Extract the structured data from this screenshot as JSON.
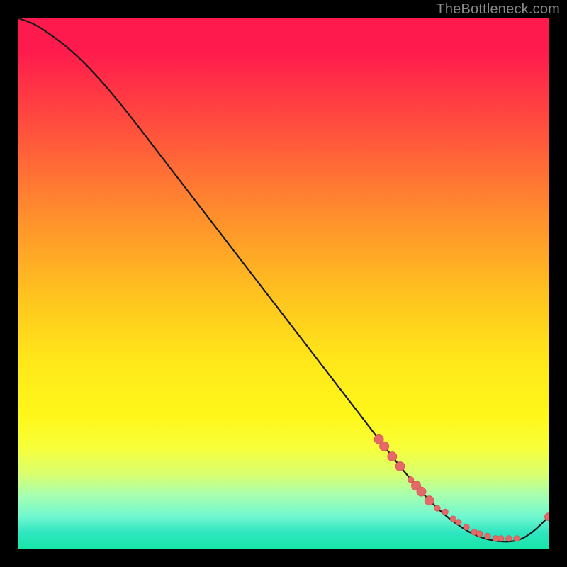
{
  "watermark": "TheBottleneck.com",
  "colors": {
    "background": "#000000",
    "curve": "#1a1a1a",
    "marker_fill": "#e46a6a",
    "marker_stroke": "#d94f4f",
    "gradient_top": "#ff1a4d",
    "gradient_bottom": "#18e6a8"
  },
  "chart_data": {
    "type": "line",
    "title": "",
    "xlabel": "",
    "ylabel": "",
    "xlim": [
      0,
      100
    ],
    "ylim": [
      0,
      100
    ],
    "grid": false,
    "legend": false,
    "series": [
      {
        "name": "curve",
        "x": [
          0,
          3,
          6,
          10,
          15,
          20,
          25,
          30,
          35,
          40,
          45,
          50,
          55,
          60,
          65,
          70,
          74,
          78,
          82,
          86,
          90,
          94,
          97,
          100
        ],
        "y": [
          100,
          99,
          97,
          94,
          89,
          83,
          76.5,
          70,
          63.5,
          57,
          50.5,
          44,
          37.5,
          31,
          24.5,
          18,
          13,
          8.5,
          5,
          2.5,
          1.3,
          1.3,
          3,
          6
        ],
        "note": "Values are percentages of the axes; y≈0 corresponds to bottom (green), y≈100 to top (red)."
      }
    ],
    "markers": [
      {
        "x": 68,
        "cluster": "upper-slope",
        "size": "large"
      },
      {
        "x": 69,
        "cluster": "upper-slope",
        "size": "large"
      },
      {
        "x": 70.5,
        "cluster": "upper-slope",
        "size": "large"
      },
      {
        "x": 72,
        "cluster": "upper-slope",
        "size": "large"
      },
      {
        "x": 74,
        "cluster": "upper-slope",
        "size": "small"
      },
      {
        "x": 75,
        "cluster": "lower-slope",
        "size": "large"
      },
      {
        "x": 76,
        "cluster": "lower-slope",
        "size": "large"
      },
      {
        "x": 77.5,
        "cluster": "lower-slope",
        "size": "large"
      },
      {
        "x": 79,
        "cluster": "lower-slope",
        "size": "small"
      },
      {
        "x": 80.5,
        "cluster": "trough",
        "size": "small"
      },
      {
        "x": 82,
        "cluster": "trough",
        "size": "small"
      },
      {
        "x": 83,
        "cluster": "trough",
        "size": "small"
      },
      {
        "x": 84.5,
        "cluster": "trough",
        "size": "small"
      },
      {
        "x": 86,
        "cluster": "trough",
        "size": "small"
      },
      {
        "x": 87,
        "cluster": "trough",
        "size": "small"
      },
      {
        "x": 88.5,
        "cluster": "trough",
        "size": "small"
      },
      {
        "x": 90,
        "cluster": "trough",
        "size": "small"
      },
      {
        "x": 91,
        "cluster": "trough",
        "size": "small"
      },
      {
        "x": 92.5,
        "cluster": "trough",
        "size": "small"
      },
      {
        "x": 94,
        "cluster": "trough",
        "size": "small"
      },
      {
        "x": 100,
        "cluster": "end",
        "size": "medium"
      }
    ]
  }
}
